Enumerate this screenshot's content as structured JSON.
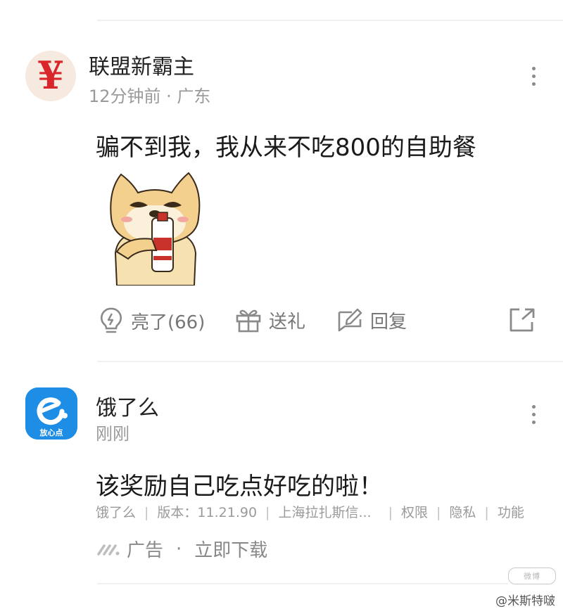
{
  "post": {
    "user_name": "联盟新霸主",
    "meta": "12分钟前 · 广东",
    "avatar_symbol": "¥",
    "text": "骗不到我，我从来不吃800的自助餐",
    "actions": {
      "like_label": "亮了(66)",
      "gift_label": "送礼",
      "reply_label": "回复"
    }
  },
  "ad": {
    "brand": "饿了么",
    "time": "刚刚",
    "avatar_caption": "放心点",
    "text": "该奖励自己吃点好吃的啦！",
    "info": {
      "app": "饿了么",
      "version": "版本：11.21.90",
      "developer": "上海拉扎斯信...",
      "permissions": "权限",
      "privacy": "隐私",
      "features": "功能"
    },
    "tag": "广告",
    "cta": "立即下载"
  },
  "watermark": {
    "box_text": "微博",
    "handle": "@米斯特啵"
  },
  "colors": {
    "accent_red": "#d8262a",
    "eleme_blue": "#1d8de6",
    "muted_text": "#9a9a9a"
  }
}
